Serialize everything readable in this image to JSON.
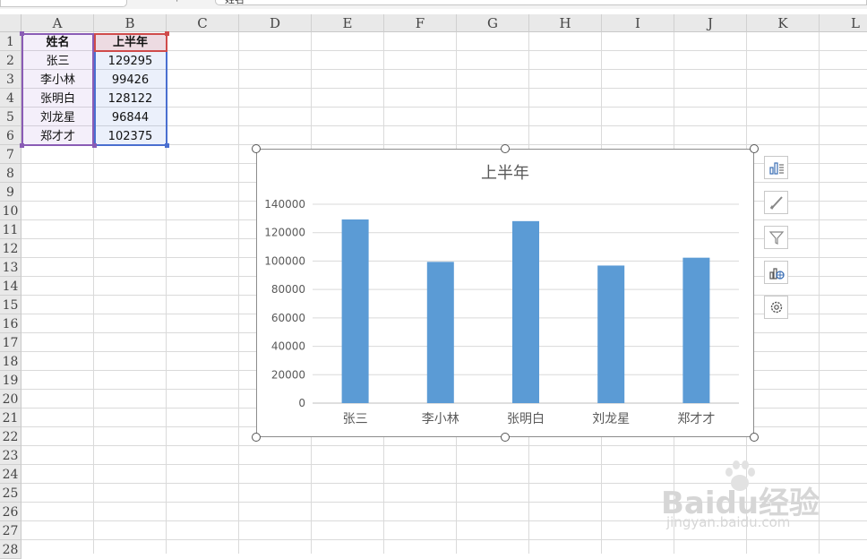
{
  "formula_bar": {
    "value": "姓名"
  },
  "columns": [
    "A",
    "B",
    "C",
    "D",
    "E",
    "F",
    "G",
    "H",
    "I",
    "J",
    "K",
    "L"
  ],
  "rows": [
    "1",
    "2",
    "3",
    "4",
    "5",
    "6",
    "7",
    "8",
    "9",
    "10",
    "11",
    "12",
    "13",
    "14",
    "15",
    "16",
    "17",
    "18",
    "19",
    "20",
    "21",
    "22",
    "23",
    "24",
    "25",
    "26",
    "27",
    "28"
  ],
  "table": {
    "headers": [
      "姓名",
      "上半年"
    ],
    "rows": [
      [
        "张三",
        "129295"
      ],
      [
        "李小林",
        "99426"
      ],
      [
        "张明白",
        "128122"
      ],
      [
        "刘龙星",
        "96844"
      ],
      [
        "郑才才",
        "102375"
      ]
    ]
  },
  "chart_data": {
    "type": "bar",
    "title": "上半年",
    "categories": [
      "张三",
      "李小林",
      "张明白",
      "刘龙星",
      "郑才才"
    ],
    "values": [
      129295,
      99426,
      128122,
      96844,
      102375
    ],
    "ylim": [
      0,
      140000
    ],
    "yticks": [
      "0",
      "20000",
      "40000",
      "60000",
      "80000",
      "100000",
      "120000",
      "140000"
    ],
    "grid": true,
    "bar_color": "#5b9bd5"
  },
  "chart_tools": [
    "chart-elements-icon",
    "chart-styles-icon",
    "chart-filters-icon",
    "data-labels-icon",
    "chart-settings-icon"
  ],
  "watermark": {
    "brand": "Baidu经验",
    "url": "jingyan.baidu.com"
  },
  "colors": {
    "selection_a": "#8a5cb5",
    "selection_b": "#4a6fd0",
    "header_b": "#cf4b4b"
  }
}
